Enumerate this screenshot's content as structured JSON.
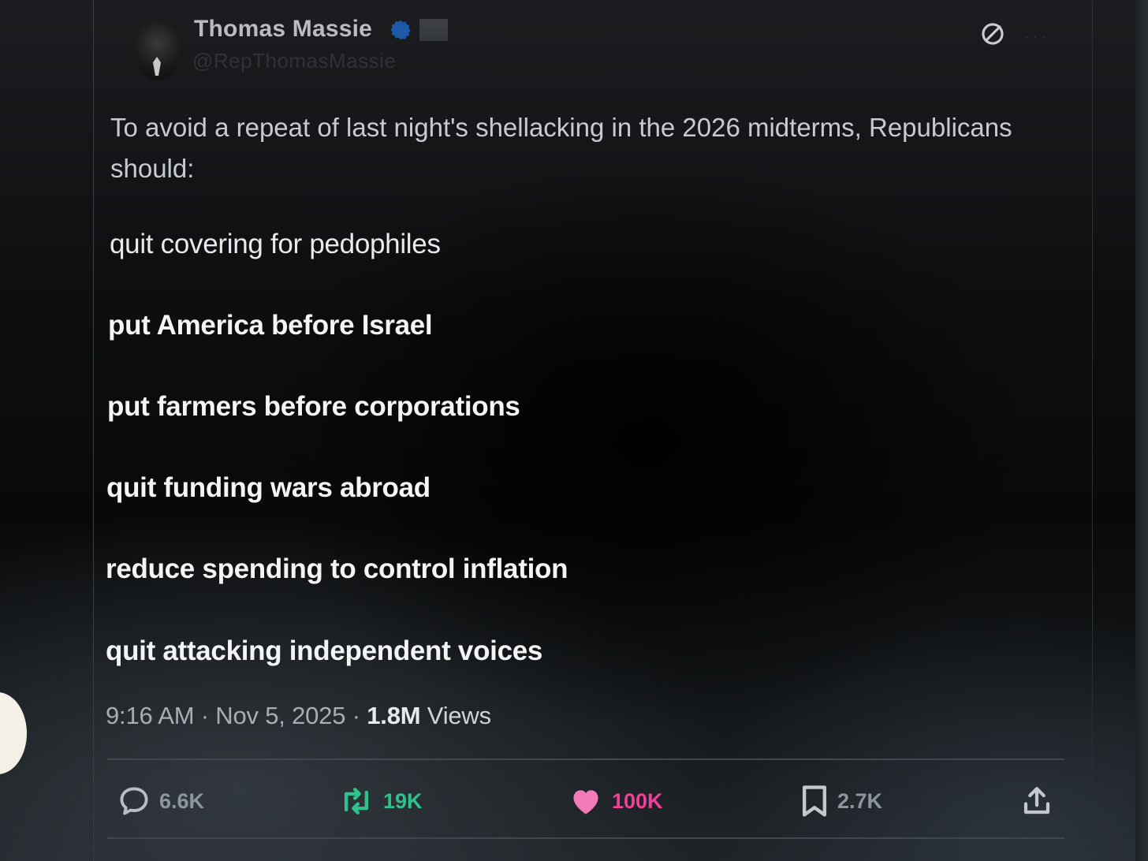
{
  "author": {
    "name": "Thomas Massie",
    "handle": "@RepThomasMassie",
    "icons": [
      "verified-icon",
      "flag-icon"
    ]
  },
  "header_icons": [
    "grok-icon",
    "more-icon"
  ],
  "more_label": "···",
  "tweet": {
    "intro": "To avoid a repeat of last night's shellacking in the 2026 midterms, Republicans should:",
    "points": [
      "quit covering for pedophiles",
      "put America before Israel",
      "put farmers before corporations",
      "quit funding wars abroad",
      "reduce spending to control inflation",
      "quit attacking independent voices"
    ]
  },
  "meta": {
    "time": "9:16 AM",
    "sep1": " · ",
    "date": "Nov 5, 2025",
    "sep2": " · ",
    "views_count": "1.8M",
    "views_label": " Views"
  },
  "actions": {
    "replies": "6.6K",
    "reposts": "19K",
    "likes": "100K",
    "bookmarks": "2.7K"
  },
  "colors": {
    "repost": "#2fc28b",
    "like": "#f0409a",
    "verified": "#1d6fd6",
    "muted": "#8e959c"
  }
}
